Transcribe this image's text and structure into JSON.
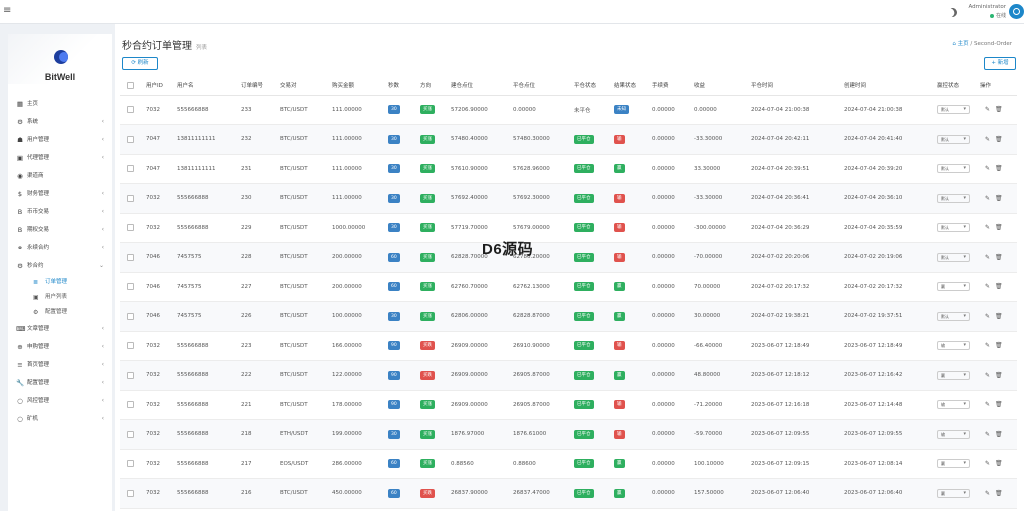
{
  "topbar": {
    "menu_icon": "hamburger-icon",
    "theme_icon": "moon-icon",
    "user_name": "Administrator",
    "user_status": "在线",
    "avatar_icon": "power-icon"
  },
  "sidebar": {
    "logo_text": "BitWell",
    "items": [
      {
        "label": "主页",
        "icon": "chart-icon",
        "glyph": "▦",
        "has_children": false
      },
      {
        "label": "系统",
        "icon": "gear-icon",
        "glyph": "⚙",
        "has_children": true
      },
      {
        "label": "用户管理",
        "icon": "users-icon",
        "glyph": "☗",
        "has_children": true
      },
      {
        "label": "代理管理",
        "icon": "id-card-icon",
        "glyph": "▣",
        "has_children": true
      },
      {
        "label": "渠道商",
        "icon": "user-circle-icon",
        "glyph": "◉",
        "has_children": false
      },
      {
        "label": "财务管理",
        "icon": "dollar-icon",
        "glyph": "$",
        "has_children": true
      },
      {
        "label": "币币交易",
        "icon": "bitcoin-icon",
        "glyph": "B",
        "has_children": true
      },
      {
        "label": "期权交易",
        "icon": "bitcoin-icon",
        "glyph": "B",
        "has_children": true
      },
      {
        "label": "永续合约",
        "icon": "link-icon",
        "glyph": "⚭",
        "has_children": true
      },
      {
        "label": "秒合约",
        "icon": "gear-icon",
        "glyph": "⚙",
        "has_children": true,
        "expanded": true
      }
    ],
    "sub_items": [
      {
        "label": "订单管理",
        "icon": "list-icon",
        "glyph": "≣",
        "current": true
      },
      {
        "label": "用户列表",
        "icon": "user-square-icon",
        "glyph": "▣",
        "current": false
      },
      {
        "label": "配置管理",
        "icon": "gear-icon",
        "glyph": "⚙",
        "current": false
      }
    ],
    "items_after": [
      {
        "label": "文章管理",
        "icon": "keyboard-icon",
        "glyph": "⌨",
        "has_children": true
      },
      {
        "label": "申购管理",
        "icon": "globe-icon",
        "glyph": "⊕",
        "has_children": true
      },
      {
        "label": "首页管理",
        "icon": "list-icon",
        "glyph": "≡",
        "has_children": true
      },
      {
        "label": "配置管理",
        "icon": "wrench-icon",
        "glyph": "🔧",
        "has_children": true
      },
      {
        "label": "风控管理",
        "icon": "circle-icon",
        "glyph": "○",
        "has_children": true
      },
      {
        "label": "矿机",
        "icon": "circle-icon",
        "glyph": "○",
        "has_children": true
      }
    ]
  },
  "page": {
    "title": "秒合约订单管理",
    "subtitle": "列表",
    "breadcrumb_home": "主页",
    "breadcrumb_sep": "/",
    "breadcrumb_current": "Second-Order",
    "refresh_label": "⟳ 刷新",
    "add_label": "+ 新增"
  },
  "table": {
    "headers": [
      "",
      "用户ID",
      "用户名",
      "订单编号",
      "交易对",
      "购买金额",
      "秒数",
      "方向",
      "建仓点位",
      "平仓点位",
      "平仓状态",
      "结果状态",
      "手续费",
      "收益",
      "平仓时间",
      "创建时间",
      "赢控状态",
      "操作"
    ],
    "rows": [
      {
        "uid": "7032",
        "name": "555666888",
        "order": "233",
        "pair": "BTC/USDT",
        "amount": "111.00000",
        "secs": "30",
        "secs_color": "blue",
        "dir": "买涨",
        "dir_color": "green",
        "open": "57206.90000",
        "close": "0.00000",
        "close_status": "未平仓",
        "close_badge": false,
        "result": "未知",
        "result_color": "blue",
        "fee": "0.00000",
        "profit": "0.00000",
        "close_time": "2024-07-04 21:00:38",
        "create_time": "2024-07-04 21:00:38",
        "ctrl": "默认"
      },
      {
        "uid": "7047",
        "name": "13811111111",
        "order": "232",
        "pair": "BTC/USDT",
        "amount": "111.00000",
        "secs": "30",
        "secs_color": "blue",
        "dir": "买涨",
        "dir_color": "green",
        "open": "57480.40000",
        "close": "57480.30000",
        "close_status": "已平仓",
        "close_badge": true,
        "result": "输",
        "result_color": "red",
        "fee": "0.00000",
        "profit": "-33.30000",
        "close_time": "2024-07-04 20:42:11",
        "create_time": "2024-07-04 20:41:40",
        "ctrl": "默认"
      },
      {
        "uid": "7047",
        "name": "13811111111",
        "order": "231",
        "pair": "BTC/USDT",
        "amount": "111.00000",
        "secs": "30",
        "secs_color": "blue",
        "dir": "买涨",
        "dir_color": "green",
        "open": "57610.90000",
        "close": "57628.96000",
        "close_status": "已平仓",
        "close_badge": true,
        "result": "赢",
        "result_color": "green",
        "fee": "0.00000",
        "profit": "33.30000",
        "close_time": "2024-07-04 20:39:51",
        "create_time": "2024-07-04 20:39:20",
        "ctrl": "默认"
      },
      {
        "uid": "7032",
        "name": "555666888",
        "order": "230",
        "pair": "BTC/USDT",
        "amount": "111.00000",
        "secs": "30",
        "secs_color": "blue",
        "dir": "买涨",
        "dir_color": "green",
        "open": "57692.40000",
        "close": "57692.30000",
        "close_status": "已平仓",
        "close_badge": true,
        "result": "输",
        "result_color": "red",
        "fee": "0.00000",
        "profit": "-33.30000",
        "close_time": "2024-07-04 20:36:41",
        "create_time": "2024-07-04 20:36:10",
        "ctrl": "默认"
      },
      {
        "uid": "7032",
        "name": "555666888",
        "order": "229",
        "pair": "BTC/USDT",
        "amount": "1000.00000",
        "secs": "30",
        "secs_color": "blue",
        "dir": "买涨",
        "dir_color": "green",
        "open": "57719.70000",
        "close": "57679.00000",
        "close_status": "已平仓",
        "close_badge": true,
        "result": "输",
        "result_color": "red",
        "fee": "0.00000",
        "profit": "-300.00000",
        "close_time": "2024-07-04 20:36:29",
        "create_time": "2024-07-04 20:35:59",
        "ctrl": "默认"
      },
      {
        "uid": "7046",
        "name": "7457575",
        "order": "228",
        "pair": "BTC/USDT",
        "amount": "200.00000",
        "secs": "60",
        "secs_color": "blue",
        "dir": "买涨",
        "dir_color": "green",
        "open": "62828.70000",
        "close": "62786.20000",
        "close_status": "已平仓",
        "close_badge": true,
        "result": "输",
        "result_color": "red",
        "fee": "0.00000",
        "profit": "-70.00000",
        "close_time": "2024-07-02 20:20:06",
        "create_time": "2024-07-02 20:19:06",
        "ctrl": "默认"
      },
      {
        "uid": "7046",
        "name": "7457575",
        "order": "227",
        "pair": "BTC/USDT",
        "amount": "200.00000",
        "secs": "60",
        "secs_color": "blue",
        "dir": "买涨",
        "dir_color": "green",
        "open": "62760.70000",
        "close": "62762.13000",
        "close_status": "已平仓",
        "close_badge": true,
        "result": "赢",
        "result_color": "green",
        "fee": "0.00000",
        "profit": "70.00000",
        "close_time": "2024-07-02 20:17:32",
        "create_time": "2024-07-02 20:17:32",
        "ctrl": "赢"
      },
      {
        "uid": "7046",
        "name": "7457575",
        "order": "226",
        "pair": "BTC/USDT",
        "amount": "100.00000",
        "secs": "30",
        "secs_color": "blue",
        "dir": "买涨",
        "dir_color": "green",
        "open": "62806.00000",
        "close": "62828.87000",
        "close_status": "已平仓",
        "close_badge": true,
        "result": "赢",
        "result_color": "green",
        "fee": "0.00000",
        "profit": "30.00000",
        "close_time": "2024-07-02 19:38:21",
        "create_time": "2024-07-02 19:37:51",
        "ctrl": "默认"
      },
      {
        "uid": "7032",
        "name": "555666888",
        "order": "223",
        "pair": "BTC/USDT",
        "amount": "166.00000",
        "secs": "90",
        "secs_color": "blue",
        "dir": "买跌",
        "dir_color": "red",
        "open": "26909.00000",
        "close": "26910.90000",
        "close_status": "已平仓",
        "close_badge": true,
        "result": "输",
        "result_color": "red",
        "fee": "0.00000",
        "profit": "-66.40000",
        "close_time": "2023-06-07 12:18:49",
        "create_time": "2023-06-07 12:18:49",
        "ctrl": "输"
      },
      {
        "uid": "7032",
        "name": "555666888",
        "order": "222",
        "pair": "BTC/USDT",
        "amount": "122.00000",
        "secs": "90",
        "secs_color": "blue",
        "dir": "买跌",
        "dir_color": "red",
        "open": "26909.00000",
        "close": "26905.87000",
        "close_status": "已平仓",
        "close_badge": true,
        "result": "赢",
        "result_color": "green",
        "fee": "0.00000",
        "profit": "48.80000",
        "close_time": "2023-06-07 12:18:12",
        "create_time": "2023-06-07 12:16:42",
        "ctrl": "赢"
      },
      {
        "uid": "7032",
        "name": "555666888",
        "order": "221",
        "pair": "BTC/USDT",
        "amount": "178.00000",
        "secs": "90",
        "secs_color": "blue",
        "dir": "买涨",
        "dir_color": "green",
        "open": "26909.00000",
        "close": "26905.87000",
        "close_status": "已平仓",
        "close_badge": true,
        "result": "输",
        "result_color": "red",
        "fee": "0.00000",
        "profit": "-71.20000",
        "close_time": "2023-06-07 12:16:18",
        "create_time": "2023-06-07 12:14:48",
        "ctrl": "输"
      },
      {
        "uid": "7032",
        "name": "555666888",
        "order": "218",
        "pair": "ETH/USDT",
        "amount": "199.00000",
        "secs": "30",
        "secs_color": "blue",
        "dir": "买涨",
        "dir_color": "green",
        "open": "1876.97000",
        "close": "1876.61000",
        "close_status": "已平仓",
        "close_badge": true,
        "result": "输",
        "result_color": "red",
        "fee": "0.00000",
        "profit": "-59.70000",
        "close_time": "2023-06-07 12:09:55",
        "create_time": "2023-06-07 12:09:55",
        "ctrl": "输"
      },
      {
        "uid": "7032",
        "name": "555666888",
        "order": "217",
        "pair": "EOS/USDT",
        "amount": "286.00000",
        "secs": "60",
        "secs_color": "blue",
        "dir": "买涨",
        "dir_color": "green",
        "open": "0.88560",
        "close": "0.88600",
        "close_status": "已平仓",
        "close_badge": true,
        "result": "赢",
        "result_color": "green",
        "fee": "0.00000",
        "profit": "100.10000",
        "close_time": "2023-06-07 12:09:15",
        "create_time": "2023-06-07 12:08:14",
        "ctrl": "赢"
      },
      {
        "uid": "7032",
        "name": "555666888",
        "order": "216",
        "pair": "BTC/USDT",
        "amount": "450.00000",
        "secs": "60",
        "secs_color": "blue",
        "dir": "买跌",
        "dir_color": "red",
        "open": "26837.90000",
        "close": "26837.47000",
        "close_status": "已平仓",
        "close_badge": true,
        "result": "赢",
        "result_color": "green",
        "fee": "0.00000",
        "profit": "157.50000",
        "close_time": "2023-06-07 12:06:40",
        "create_time": "2023-06-07 12:06:40",
        "ctrl": "赢"
      }
    ]
  },
  "watermark": "D6源码",
  "colors": {
    "accent": "#1d87c9",
    "green": "#2eaf5f",
    "red": "#e0524d",
    "blue": "#3b82c4"
  }
}
